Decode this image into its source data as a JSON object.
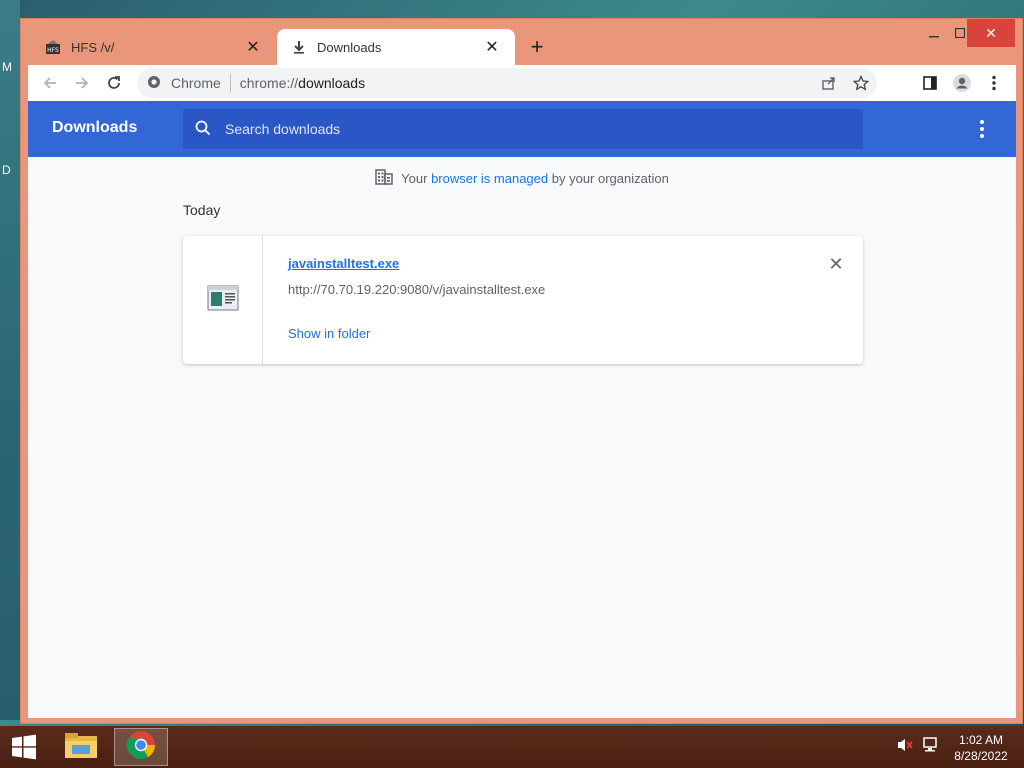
{
  "desktop": {
    "left_letters": [
      "M",
      "D"
    ]
  },
  "tabs": [
    {
      "title": "HFS /v/",
      "icon": "hfs-icon",
      "active": false
    },
    {
      "title": "Downloads",
      "icon": "download-icon",
      "active": true
    }
  ],
  "omnibox": {
    "site_label": "Chrome",
    "url_scheme": "chrome://",
    "url_rest": "downloads"
  },
  "downloads_page": {
    "title": "Downloads",
    "search_placeholder": "Search downloads",
    "managed_prefix": "Your",
    "managed_link": "browser is managed",
    "managed_suffix": "by your organization",
    "date_group": "Today",
    "item": {
      "filename": "javainstalltest.exe",
      "url": "http://70.70.19.220:9080/v/javainstalltest.exe",
      "action": "Show in folder"
    }
  },
  "taskbar": {
    "time": "1:02 AM",
    "date": "8/28/2022"
  },
  "colors": {
    "accent": "#3367d6",
    "search_bg": "#2a56c6",
    "link": "#1a73e8",
    "window_frame": "#e9967a"
  }
}
